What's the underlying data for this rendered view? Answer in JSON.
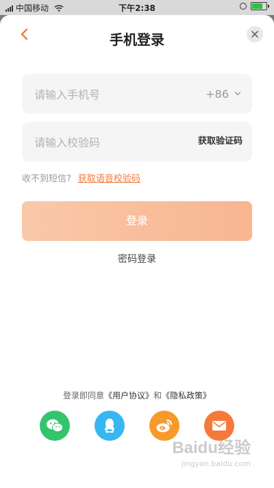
{
  "status_bar": {
    "carrier": "中国移动",
    "time": "下午2:38"
  },
  "header": {
    "title": "手机登录"
  },
  "phone_field": {
    "placeholder": "请输入手机号",
    "country_code": "+86"
  },
  "code_field": {
    "placeholder": "请输入校验码",
    "get_code_label": "获取验证码"
  },
  "hint": {
    "prefix": "收不到短信?",
    "voice_link": "获取语音校验码"
  },
  "login_button": "登录",
  "password_login": "密码登录",
  "agreement": {
    "prefix": "登录即同意",
    "user_agreement": "《用户协议》",
    "and": "和",
    "privacy_policy": "《隐私政策》"
  },
  "social_logins": [
    "wechat-icon",
    "qq-icon",
    "weibo-icon",
    "mail-icon"
  ],
  "watermark": {
    "brand": "Baidu经验",
    "url": "jingyan.baidu.com"
  },
  "colors": {
    "accent": "#f07a3c",
    "login_button": "#f8b591",
    "wechat": "#34c46c",
    "qq": "#38b6f2",
    "weibo": "#f79a2a",
    "mail": "#f47a3c"
  }
}
